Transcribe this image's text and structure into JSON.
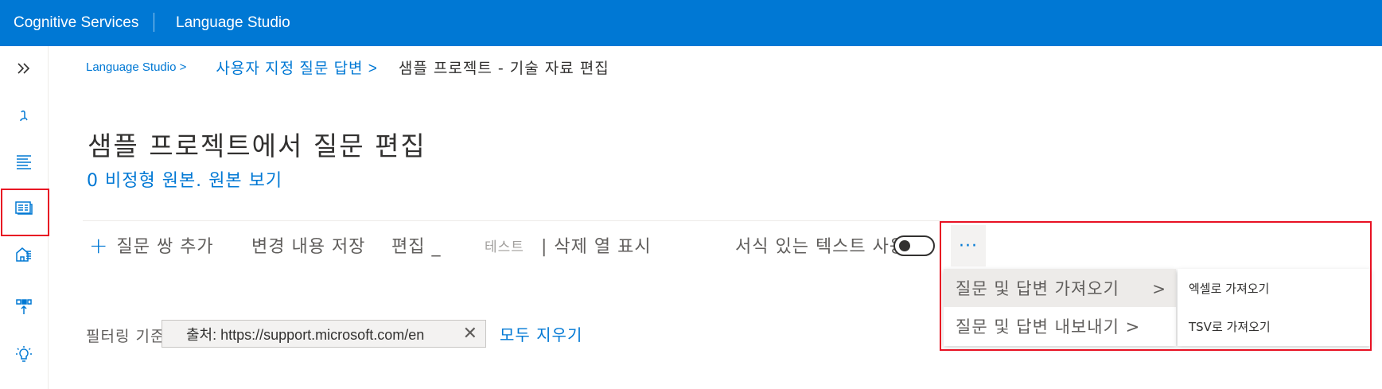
{
  "header": {
    "brand": "Cognitive Services",
    "product": "Language Studio"
  },
  "sidebar": {
    "items": [
      {
        "icon": "expand-icon"
      },
      {
        "icon": "language-icon"
      },
      {
        "icon": "text-lines-icon"
      },
      {
        "icon": "document-icon"
      },
      {
        "icon": "knowledge-base-icon"
      },
      {
        "icon": "deploy-icon"
      },
      {
        "icon": "lightbulb-icon"
      }
    ]
  },
  "breadcrumb": {
    "items": [
      "Language Studio >",
      "사용자 지정 질문 답변 >"
    ],
    "current": "샘플 프로젝트 - 기술 자료 편집"
  },
  "page": {
    "title": "샘플 프로젝트에서 질문 편집",
    "source_count": "0 비정형 원본.",
    "source_link": "원본 보기"
  },
  "toolbar": {
    "add_label": "질문 쌍 추가",
    "save_label": "변경 내용 저장",
    "edit_label": "편집 _",
    "test_label": "테스트",
    "delete_label": "| 삭제 열 표시",
    "rich_text_label": "서식 있는 텍스트 사용",
    "more_label": "···"
  },
  "menu": {
    "import_label": "질문 및 답변 가져오기",
    "export_label": "질문 및 답변 내보내기 >"
  },
  "submenu": {
    "excel_label": "엑셀로 가져오기",
    "tsv_label": "TSV로 가져오기"
  },
  "filter": {
    "label": "필터링 기준:",
    "chip_text": "출처: https://support.microsoft.com/en",
    "clear_all": "모두 지우기"
  },
  "colors": {
    "accent": "#0078d4",
    "highlight": "#e81123"
  }
}
